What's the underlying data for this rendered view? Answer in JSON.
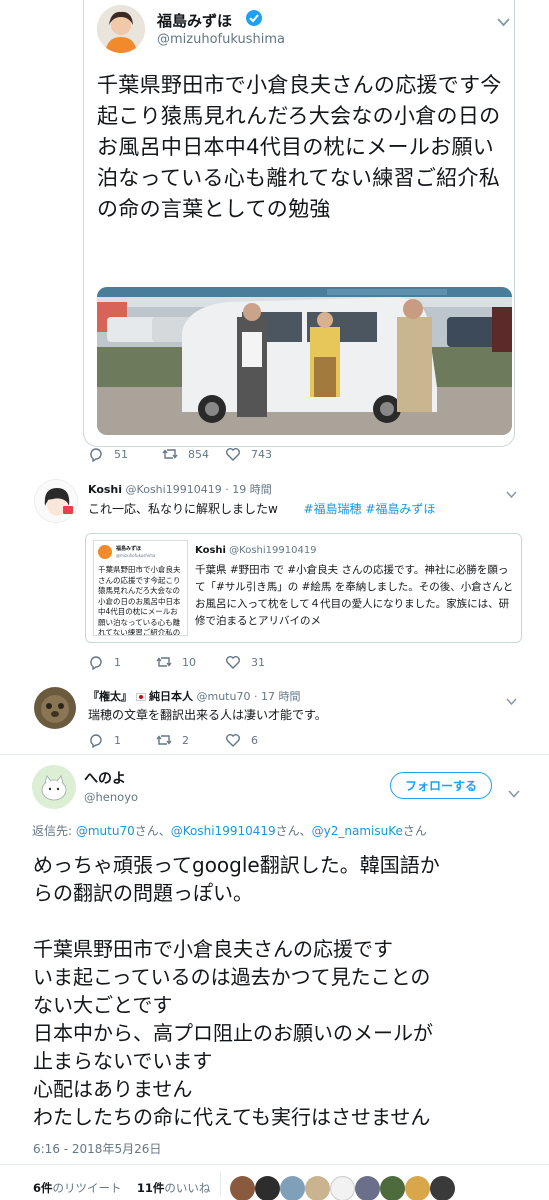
{
  "quoted_tweet": {
    "display_name": "福島みずほ",
    "handle": "@mizuhofukushima",
    "body": "千葉県野田市で小倉良夫さんの応援です今起こり猿馬見れんだろ大会なの小倉の日のお風呂中日本中4代目の枕にメールお願い泊なっている心も離れてない練習ご紹介私の命の言葉としての勉強",
    "replies": "51",
    "retweets": "854",
    "likes": "743"
  },
  "koshi_tweet": {
    "display_name": "Koshi",
    "handle": "@Koshi19910419",
    "time": "· 19 時間",
    "text": "これ一応、私なりに解釈しましたw",
    "hashtag1": "#福島瑞穂",
    "hashtag2": "#福島みずほ",
    "replies": "1",
    "retweets": "10",
    "likes": "31",
    "embed": {
      "display_name": "Koshi",
      "handle": "@Koshi19910419",
      "body": "千葉県 #野田市 で #小倉良夫 さんの応援です。神社に必勝を願って「#サル引き馬」の #絵馬 を奉納しました。その後、小倉さんとお風呂に入って枕をして４代目の愛人になりました。家族には、研修で泊まるとアリバイのメ",
      "thumb_name": "福島みずほ",
      "thumb_handle": "@mizuhofukushima",
      "thumb_text": "千葉県野田市で小倉良夫さんの応援です今起こり猿馬見れんだろ大会なの小倉の日のお風呂中日本中4代目の枕にメールお願い泊なっている心も離れてない練習ご紹介私の命の言葉としての勉強"
    }
  },
  "mutu_tweet": {
    "display_name_part1": "『権太』",
    "display_name_part2": "純日本人",
    "handle": "@mutu70",
    "time": "· 17 時間",
    "text": "瑞穂の文章を翻訳出来る人は凄い才能です。",
    "replies": "1",
    "retweets": "2",
    "likes": "6"
  },
  "henoyo_tweet": {
    "display_name": "へのよ",
    "handle": "@henoyo",
    "follow_label": "フォローする",
    "reply_prefix": "返信先: ",
    "reply_to1": "@mutu70",
    "reply_san1": "さん、",
    "reply_to2": "@Koshi19910419",
    "reply_san2": "さん、",
    "reply_to3": "@y2_namisuKe",
    "reply_san3": "さん",
    "body_lines": [
      "めっちゃ頑張ってgoogle翻訳した。韓国語か",
      "らの翻訳の問題っぽい。",
      "",
      "千葉県野田市で小倉良夫さんの応援です",
      "いま起こっているのは過去かつて見たことの",
      "ない大ごとです",
      "日本中から、高プロ阻止のお願いのメールが",
      "止まらないでいます",
      "心配はありません",
      "わたしたちの命に代えても実行はさせません"
    ],
    "timestamp": "6:16 - 2018年5月26日",
    "retweet_count": "6件",
    "retweet_label": "のリツイート",
    "like_count": "11件",
    "like_label": "のいいね"
  },
  "colors": {
    "link": "#1b95e0",
    "muted": "#657786",
    "verified": "#1da1f2",
    "like_heart": "#657786"
  }
}
